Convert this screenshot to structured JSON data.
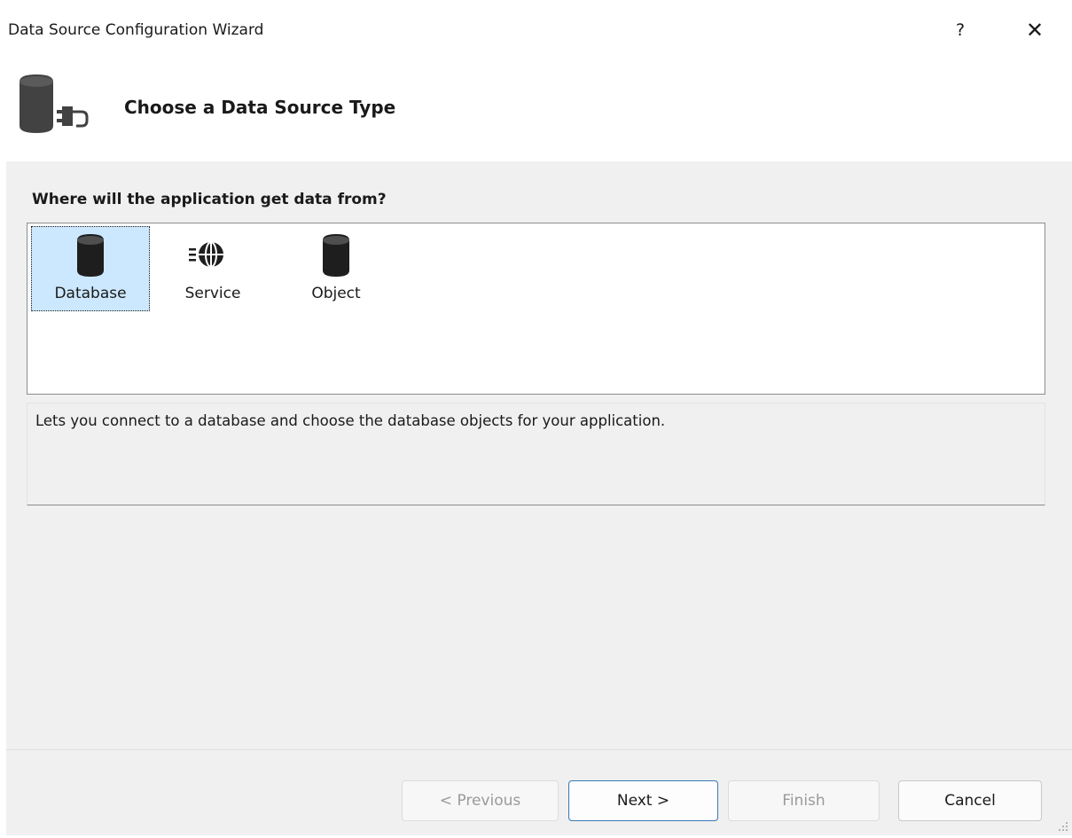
{
  "window": {
    "title": "Data Source Configuration Wizard",
    "help_label": "?",
    "close_label": "✕"
  },
  "header": {
    "title": "Choose a Data Source Type"
  },
  "main": {
    "prompt": "Where will the application get data from?",
    "items": [
      {
        "label": "Database",
        "icon": "database-icon",
        "selected": true
      },
      {
        "label": "Service",
        "icon": "globe-service-icon",
        "selected": false
      },
      {
        "label": "Object",
        "icon": "object-icon",
        "selected": false
      }
    ],
    "description": "Lets you connect to a database and choose the database objects for your application."
  },
  "footer": {
    "previous_label": "< Previous",
    "next_label": "Next >",
    "finish_label": "Finish",
    "cancel_label": "Cancel"
  },
  "colors": {
    "selection": "#cce8ff",
    "content_bg": "#f0f0f0",
    "default_button_border": "#3a78b5"
  }
}
